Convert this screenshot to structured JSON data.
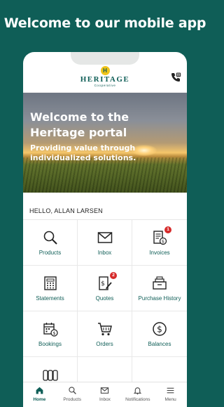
{
  "headline": "Welcome to our mobile app",
  "app": {
    "logo_letter": "H",
    "logo_word": "HERITAGE",
    "logo_sub": "Cooperative"
  },
  "hero": {
    "title_line1": "Welcome to the",
    "title_line2": "Heritage portal",
    "subtitle": "Providing value through individualized solutions."
  },
  "greeting": "HELLO, ALLAN LARSEN",
  "tiles": [
    {
      "label": "Products",
      "icon": "magnifier-icon"
    },
    {
      "label": "Inbox",
      "icon": "envelope-icon"
    },
    {
      "label": "Invoices",
      "icon": "invoice-icon",
      "badge": "1"
    },
    {
      "label": "Statements",
      "icon": "statement-icon"
    },
    {
      "label": "Quotes",
      "icon": "quote-icon",
      "badge": "2"
    },
    {
      "label": "Purchase History",
      "icon": "history-icon"
    },
    {
      "label": "Bookings",
      "icon": "calendar-icon"
    },
    {
      "label": "Orders",
      "icon": "cart-icon"
    },
    {
      "label": "Balances",
      "icon": "dollar-icon"
    }
  ],
  "nav": [
    {
      "label": "Home",
      "icon": "home-icon",
      "active": true
    },
    {
      "label": "Products",
      "icon": "search-icon"
    },
    {
      "label": "Inbox",
      "icon": "mail-icon"
    },
    {
      "label": "Notifications",
      "icon": "bell-icon"
    },
    {
      "label": "Menu",
      "icon": "menu-icon"
    }
  ],
  "colors": {
    "brand": "#0f5e57",
    "accent": "#f0c419",
    "badge": "#d62b2b"
  }
}
